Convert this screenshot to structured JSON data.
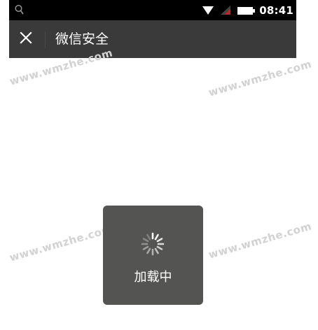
{
  "status_bar": {
    "time": "08:41",
    "icons": [
      "search-icon",
      "wifi-icon",
      "signal-icon",
      "battery-icon"
    ]
  },
  "header": {
    "close_icon": "close-icon",
    "title": "微信安全"
  },
  "watermark": {
    "text": "www.wmzhe.com"
  },
  "loading": {
    "text": "加载中",
    "icon": "spinner-icon"
  },
  "colors": {
    "status_bar_bg": "#000000",
    "title_bar_bg": "#3a3a3a",
    "toast_bg": "#545552",
    "signal_accent": "#c0262c"
  }
}
